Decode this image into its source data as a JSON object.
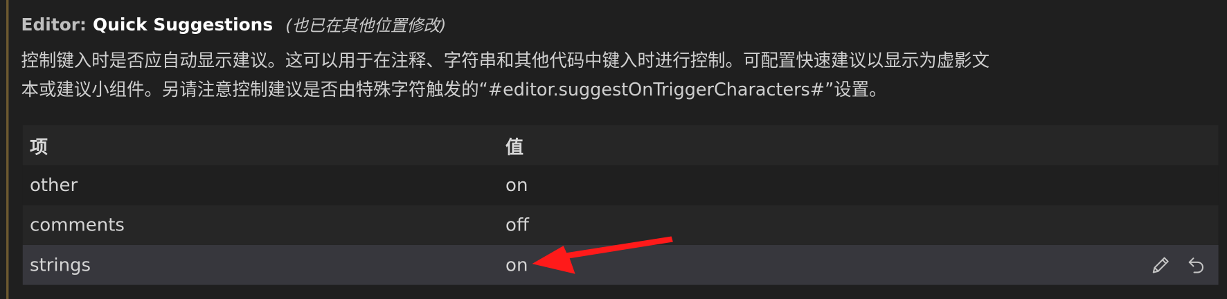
{
  "setting": {
    "category": "Editor:",
    "label": "Quick Suggestions",
    "modified_note": "(也已在其他位置修改)",
    "description_lines": [
      "控制键入时是否应自动显示建议。这可以用于在注释、字符串和其他代码中键入时进行控制。可配置快速建议以显示为虚影文",
      "本或建议小组件。另请注意控制建议是否由特殊字符触发的“#editor.suggestOnTriggerCharacters#”设置。"
    ]
  },
  "table": {
    "headers": {
      "item": "项",
      "value": "值"
    },
    "rows": [
      {
        "item": "other",
        "value": "on"
      },
      {
        "item": "comments",
        "value": "off"
      },
      {
        "item": "strings",
        "value": "on"
      }
    ]
  },
  "icons": {
    "edit": "pencil-icon",
    "reset": "undo-icon"
  },
  "colors": {
    "modified_bar": "#6d5930",
    "annotation_arrow": "#ff1a1a",
    "selected_row": "#37373d"
  }
}
